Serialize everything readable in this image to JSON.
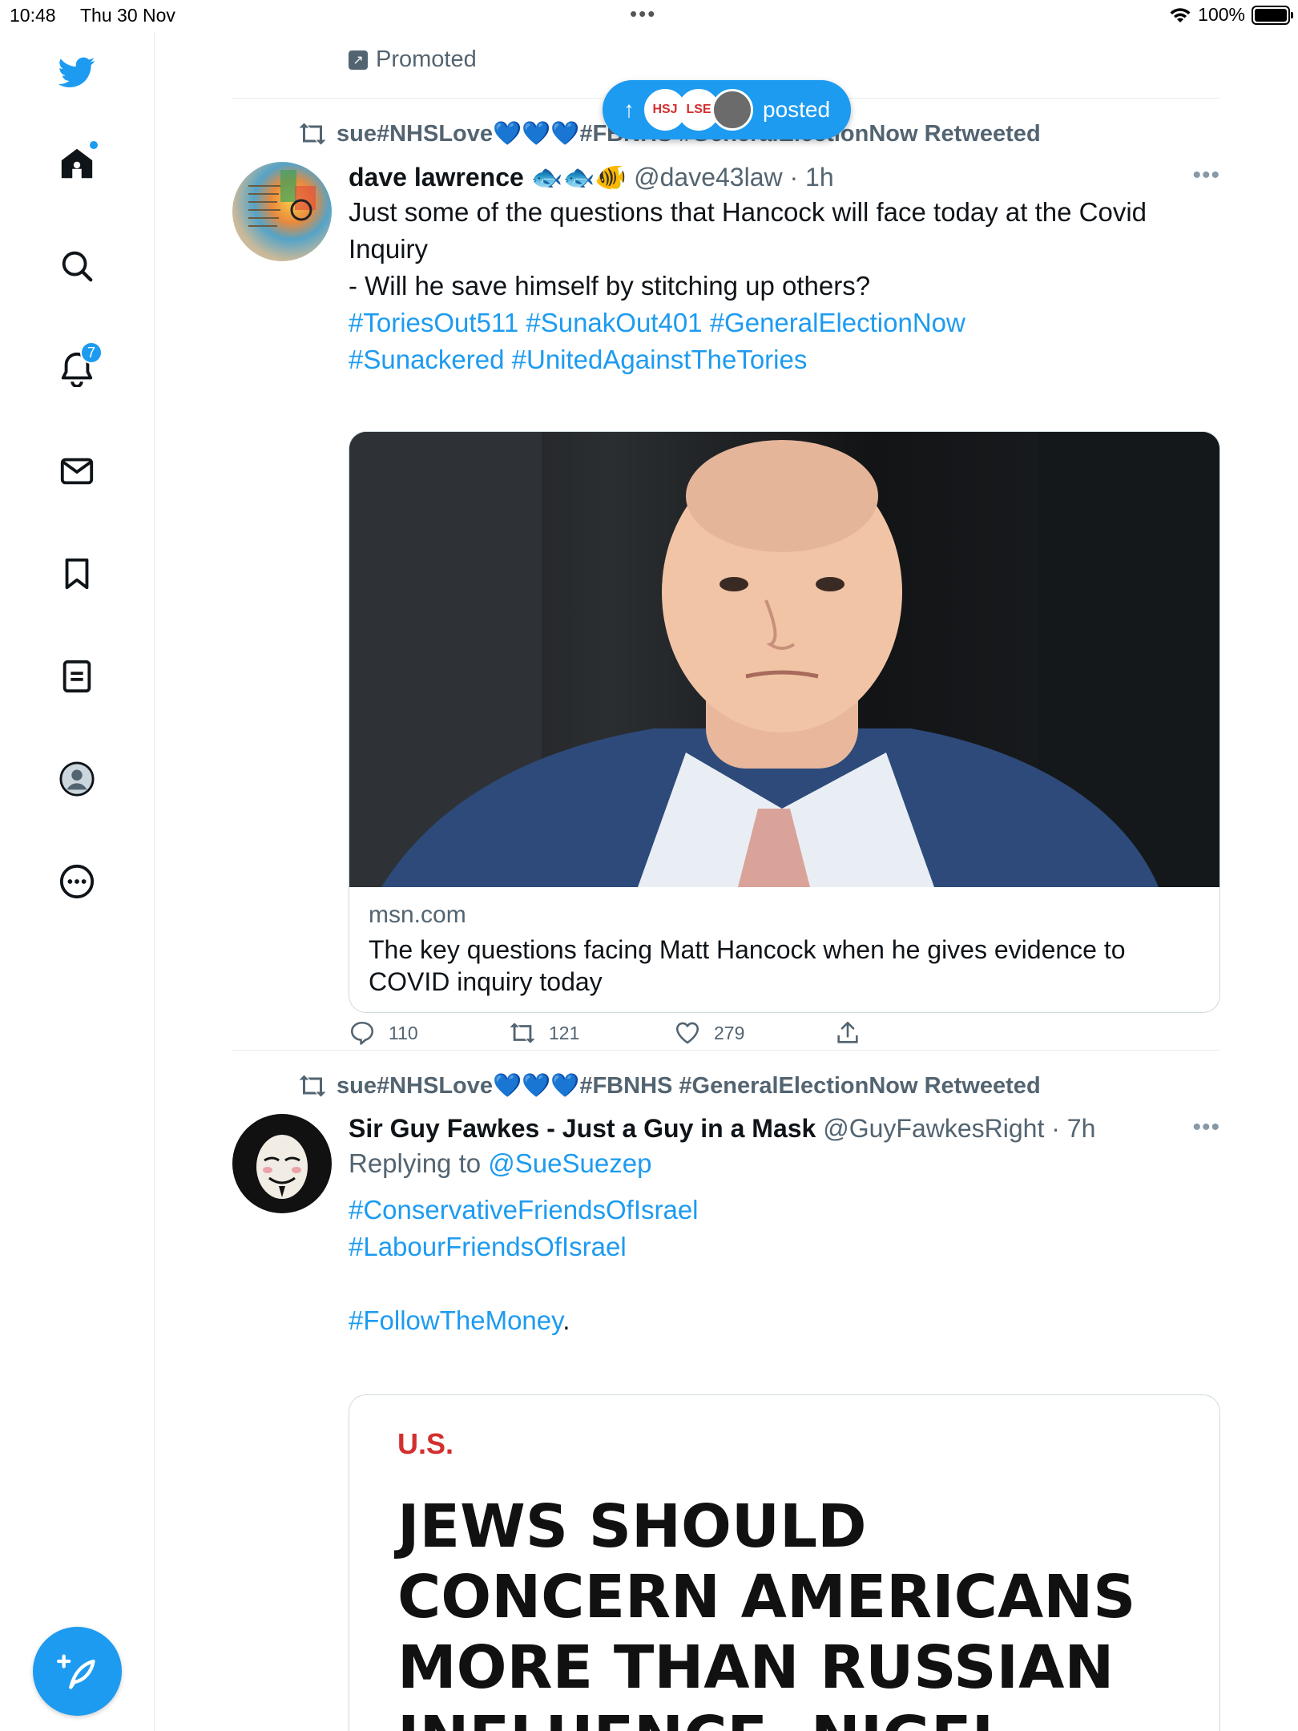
{
  "status_bar": {
    "time": "10:48",
    "date": "Thu 30 Nov",
    "battery": "100%"
  },
  "sidebar": {
    "items": [
      "twitter-logo",
      "home",
      "explore",
      "notifications",
      "messages",
      "bookmarks",
      "lists",
      "profile",
      "more"
    ],
    "notification_count": "7"
  },
  "promoted": {
    "label": "Promoted"
  },
  "new_posts_pill": {
    "label": "posted",
    "avatars": [
      "HSJ",
      "LSE",
      ""
    ]
  },
  "tweets": [
    {
      "retweeted_by": "sue#NHSLove💙💙💙#FBNHS #GeneralElectionNow Retweeted",
      "name": "dave lawrence",
      "emoji": "🐟🐟🐠",
      "handle": "@dave43law",
      "time": "· 1h",
      "text_lines": [
        "Just some of the questions that Hancock will face today at the Covid",
        "Inquiry",
        "- Will he save himself by stitching up others?"
      ],
      "hashtag_lines": [
        "#ToriesOut511 #SunakOut401 #GeneralElectionNow",
        "#Sunackered #UnitedAgainstTheTories"
      ],
      "card": {
        "domain": "msn.com",
        "title": "The key questions facing Matt Hancock when he gives evidence to COVID inquiry today"
      },
      "actions": {
        "replies": "110",
        "retweets": "121",
        "likes": "279"
      }
    },
    {
      "retweeted_by": "sue#NHSLove💙💙💙#FBNHS #GeneralElectionNow Retweeted",
      "name": "Sir Guy Fawkes - Just a Guy in a Mask",
      "handle": "@GuyFawkesRight",
      "time": "· 7h",
      "replying_to_label": "Replying to",
      "replying_to_handle": "@SueSuezep",
      "hashtag_lines": [
        "#ConservativeFriendsOfIsrael",
        "#LabourFriendsOfIsrael"
      ],
      "follow_tag": "#FollowTheMoney",
      "follow_suffix": ".",
      "article": {
        "kicker": "U.S.",
        "headline_lines": [
          "JEWS SHOULD",
          "CONCERN AMERICANS",
          "MORE THAN RUSSIAN",
          "INFLUENCE, NIGEL"
        ]
      }
    }
  ],
  "colors": {
    "accent": "#1d9bf0",
    "text": "#0f1419",
    "muted": "#536471",
    "border": "#e6ecf0"
  }
}
